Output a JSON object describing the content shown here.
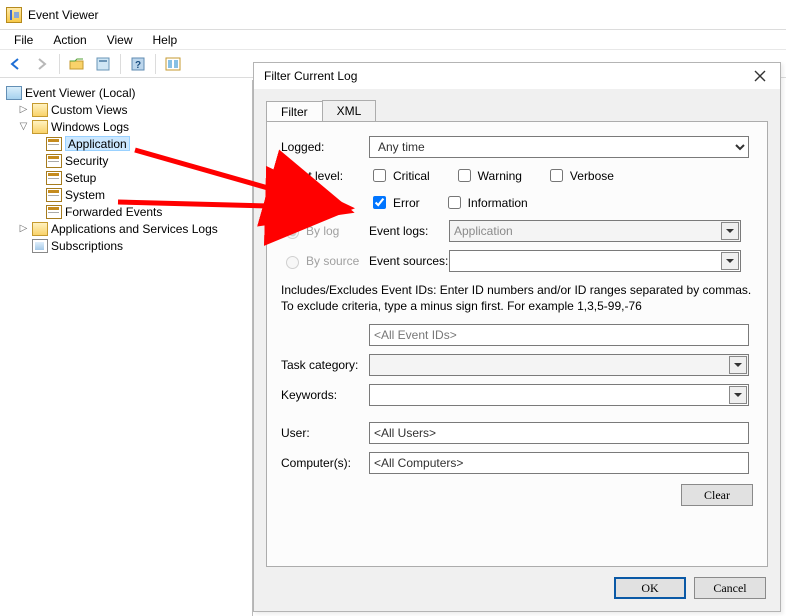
{
  "window": {
    "title": "Event Viewer"
  },
  "menu": {
    "file": "File",
    "action": "Action",
    "view": "View",
    "help": "Help"
  },
  "toolbar": {
    "back": "back-icon",
    "forward": "forward-icon",
    "open": "open-icon",
    "properties": "properties-icon",
    "help": "help-icon",
    "list": "list-icon"
  },
  "tree": {
    "root": "Event Viewer (Local)",
    "custom_views": "Custom Views",
    "windows_logs": "Windows Logs",
    "logs": {
      "application": "Application",
      "security": "Security",
      "setup": "Setup",
      "system": "System",
      "forwarded": "Forwarded Events"
    },
    "apps_logs": "Applications and Services Logs",
    "subscriptions": "Subscriptions"
  },
  "dialog": {
    "title": "Filter Current Log",
    "tabs": {
      "filter": "Filter",
      "xml": "XML"
    },
    "labels": {
      "logged": "Logged:",
      "event_level": "Event level:",
      "by_log": "By log",
      "by_source": "By source",
      "event_logs": "Event logs:",
      "event_sources": "Event sources:",
      "task_category": "Task category:",
      "keywords": "Keywords:",
      "user": "User:",
      "computers": "Computer(s):"
    },
    "logged_value": "Any time",
    "levels": {
      "critical": "Critical",
      "warning": "Warning",
      "verbose": "Verbose",
      "error": "Error",
      "information": "Information"
    },
    "levels_state": {
      "critical": false,
      "warning": false,
      "verbose": false,
      "error": true,
      "information": false
    },
    "radio_state": {
      "by_log": true,
      "by_source": false
    },
    "event_logs_value": "Application",
    "event_sources_value": "",
    "help_text": "Includes/Excludes Event IDs: Enter ID numbers and/or ID ranges separated by commas. To exclude criteria, type a minus sign first. For example 1,3,5-99,-76",
    "event_ids_value": "<All Event IDs>",
    "task_category_value": "",
    "keywords_value": "",
    "user_value": "<All Users>",
    "computers_value": "<All Computers>",
    "buttons": {
      "clear": "Clear",
      "ok": "OK",
      "cancel": "Cancel"
    }
  }
}
